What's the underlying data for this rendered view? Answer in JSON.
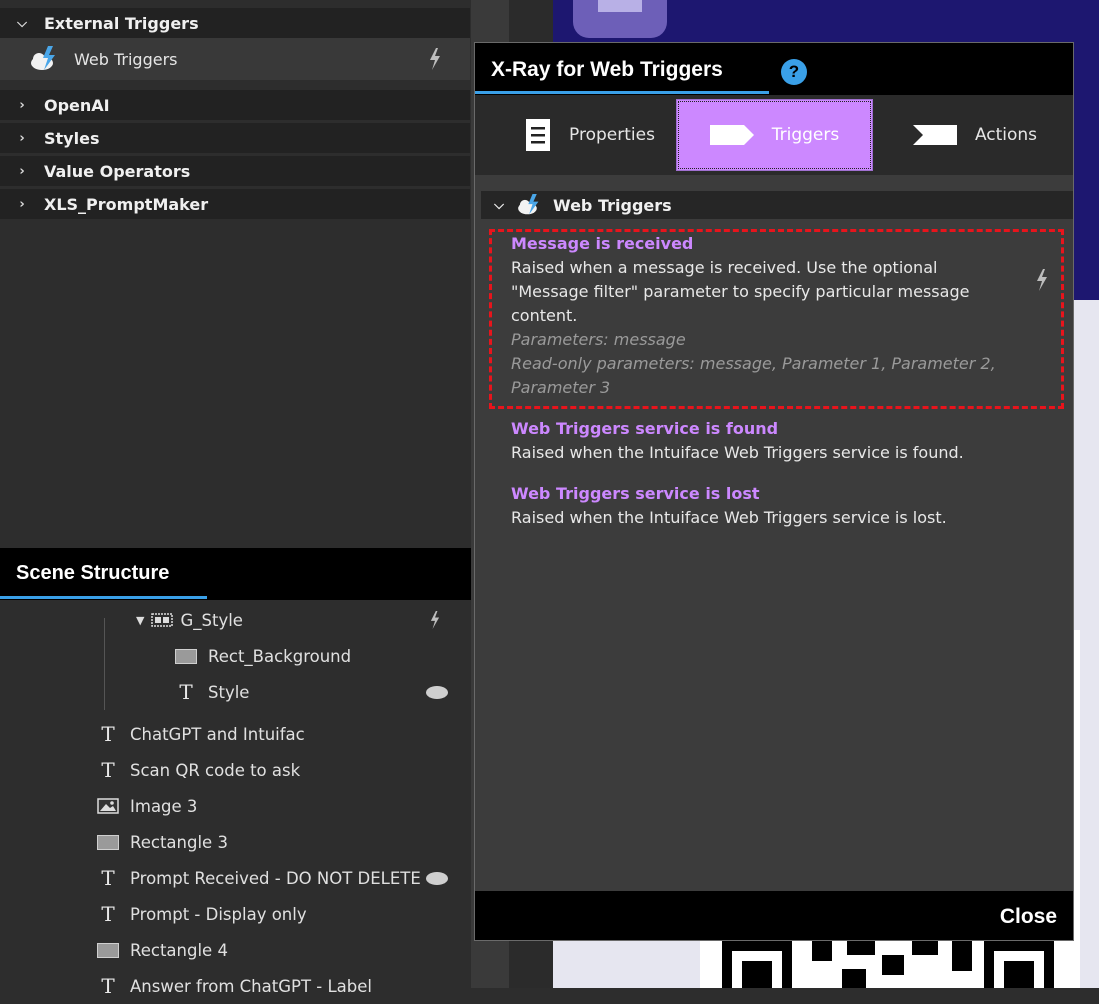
{
  "library": {
    "categories": [
      {
        "label": "External Triggers",
        "expanded": true
      },
      {
        "label": "OpenAI",
        "expanded": false
      },
      {
        "label": "Styles",
        "expanded": false
      },
      {
        "label": "Value Operators",
        "expanded": false
      },
      {
        "label": "XLS_PromptMaker",
        "expanded": false
      }
    ],
    "selected_item": {
      "label": "Web Triggers",
      "icon": "web-triggers-icon"
    }
  },
  "scene_structure": {
    "title": "Scene Structure",
    "items": [
      {
        "label": "G_Style",
        "icon": "group-icon"
      },
      {
        "label": "Rect_Background",
        "icon": "rectangle-icon"
      },
      {
        "label": "Style",
        "icon": "text-icon"
      },
      {
        "label": "ChatGPT and Intuifac",
        "icon": "text-icon"
      },
      {
        "label": "Scan QR code to ask",
        "icon": "text-icon"
      },
      {
        "label": "Image 3",
        "icon": "image-icon"
      },
      {
        "label": "Rectangle 3",
        "icon": "rectangle-icon"
      },
      {
        "label": "Prompt Received - DO NOT DELETE",
        "icon": "text-icon"
      },
      {
        "label": "Prompt - Display only",
        "icon": "text-icon"
      },
      {
        "label": "Rectangle 4",
        "icon": "rectangle-icon"
      },
      {
        "label": "Answer from ChatGPT - Label",
        "icon": "text-icon"
      }
    ]
  },
  "xray": {
    "title": "X-Ray for Web Triggers",
    "help_label": "?",
    "tabs": [
      {
        "label": "Properties",
        "selected": false
      },
      {
        "label": "Triggers",
        "selected": true
      },
      {
        "label": "Actions",
        "selected": false
      }
    ],
    "section_title": "Web Triggers",
    "triggers": [
      {
        "name": "Message is received",
        "description": "Raised when a message is received. Use the optional \"Message filter\" parameter to specify particular message content.",
        "parameters": "Parameters: message",
        "readonly_parameters": "Read-only parameters: message, Parameter 1, Parameter 2, Parameter 3"
      },
      {
        "name": "Web Triggers service is found",
        "description": "Raised when the Intuiface Web Triggers service is found."
      },
      {
        "name": "Web Triggers service is lost",
        "description": "Raised when the Intuiface Web Triggers service is lost."
      }
    ],
    "close_label": "Close"
  },
  "colors": {
    "accent_blue": "#3aa0e8",
    "trigger_purple": "#cc88ff",
    "selection_red": "#e8141c"
  }
}
